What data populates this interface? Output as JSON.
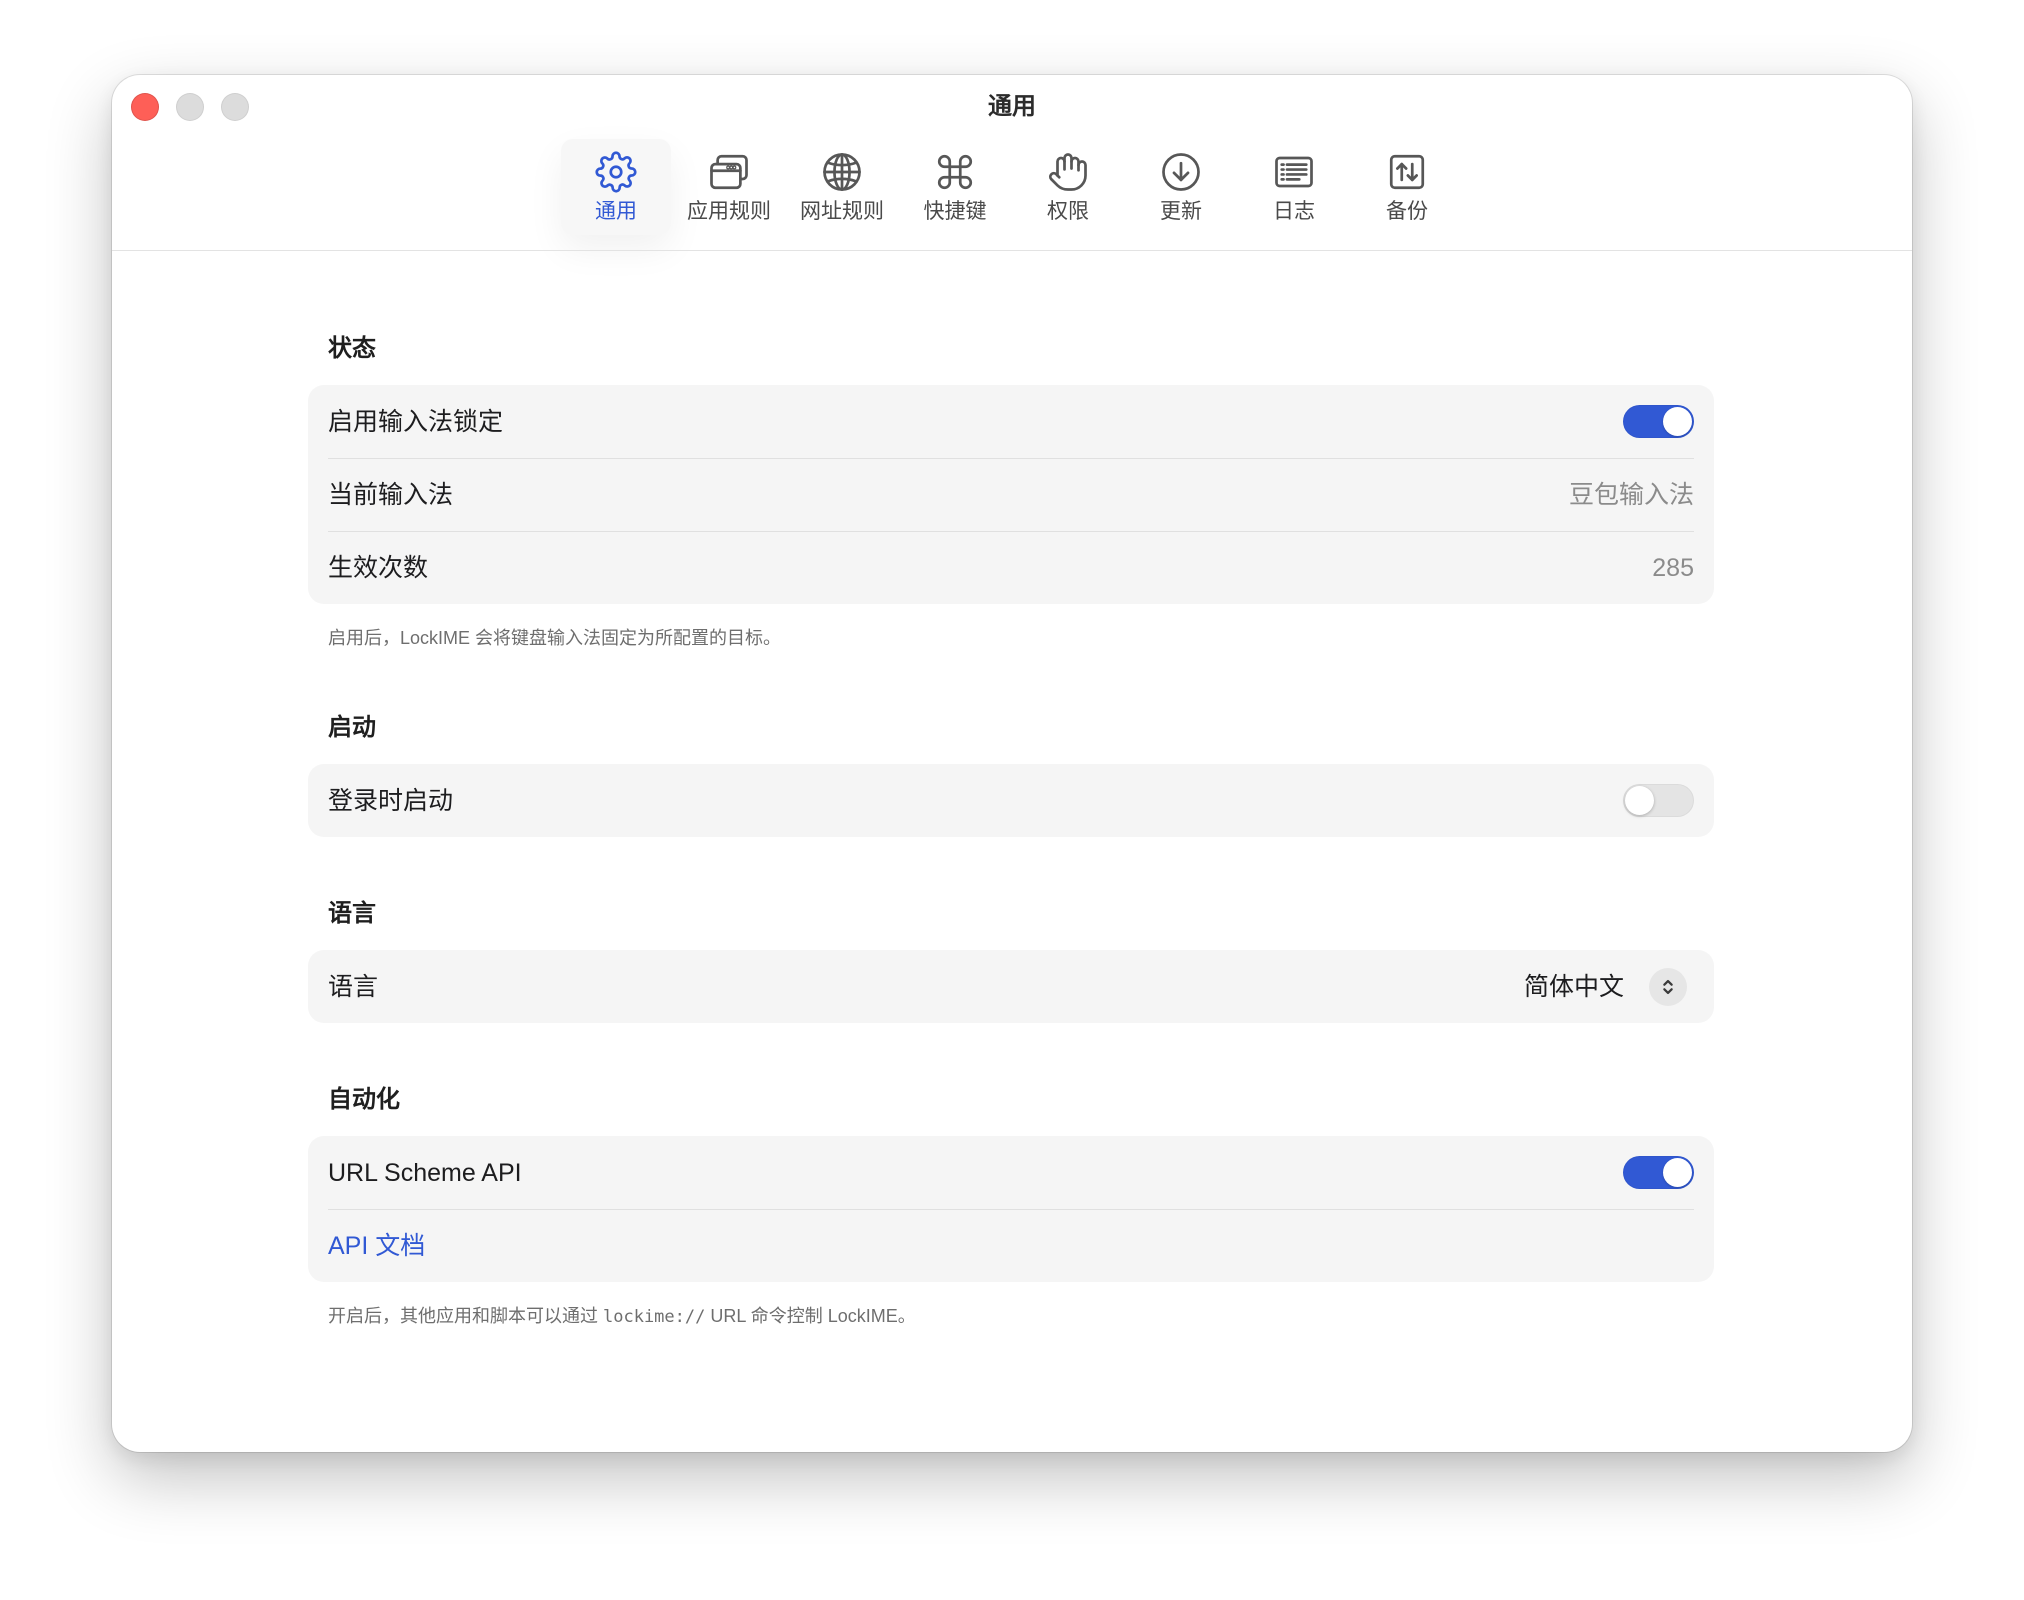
{
  "window": {
    "title": "通用"
  },
  "toolbar": {
    "items": [
      {
        "label": "通用",
        "icon": "gear-icon",
        "selected": true
      },
      {
        "label": "应用规则",
        "icon": "app-windows-icon",
        "selected": false
      },
      {
        "label": "网址规则",
        "icon": "globe-icon",
        "selected": false
      },
      {
        "label": "快捷键",
        "icon": "command-icon",
        "selected": false
      },
      {
        "label": "权限",
        "icon": "hand-icon",
        "selected": false
      },
      {
        "label": "更新",
        "icon": "arrow-down-circle-icon",
        "selected": false
      },
      {
        "label": "日志",
        "icon": "log-list-icon",
        "selected": false
      },
      {
        "label": "备份",
        "icon": "backup-arrows-icon",
        "selected": false
      }
    ]
  },
  "sections": {
    "status": {
      "title": "状态",
      "enable_lock": {
        "label": "启用输入法锁定",
        "enabled": true
      },
      "current_ime": {
        "label": "当前输入法",
        "value": "豆包输入法"
      },
      "activation_count": {
        "label": "生效次数",
        "value": "285"
      },
      "footnote": "启用后，LockIME 会将键盘输入法固定为所配置的目标。"
    },
    "startup": {
      "title": "启动",
      "launch_at_login": {
        "label": "登录时启动",
        "enabled": false
      }
    },
    "language": {
      "title": "语言",
      "language_select": {
        "label": "语言",
        "value": "简体中文",
        "icon": "chevron-up-down-icon"
      }
    },
    "automation": {
      "title": "自动化",
      "url_scheme": {
        "label": "URL Scheme API",
        "enabled": true
      },
      "api_docs_link": {
        "label": "API 文档"
      },
      "footnote": {
        "prefix": "开启后，其他应用和脚本可以通过 ",
        "code": "lockime://",
        "suffix": " URL 命令控制 LockIME。"
      }
    }
  },
  "colors": {
    "accent": "#3159d4",
    "close_button": "#fe5f57",
    "group_background": "#f5f5f5"
  }
}
